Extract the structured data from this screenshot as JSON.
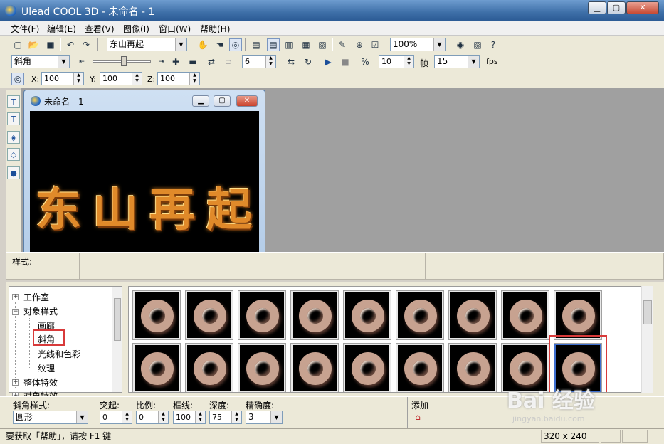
{
  "window": {
    "title": "Ulead COOL 3D - 未命名 - 1",
    "min": "▁",
    "max": "▢",
    "close": "✕"
  },
  "menu": [
    "文件(F)",
    "编辑(E)",
    "查看(V)",
    "图像(I)",
    "窗口(W)",
    "帮助(H)"
  ],
  "toolbar1": {
    "text_object": "东山再起",
    "zoom": "100%"
  },
  "toolbar2": {
    "attribute": "斜角",
    "frame_value": "6",
    "frames_value": "10",
    "frames_label": "帧",
    "fps_value": "15",
    "fps_label": "fps"
  },
  "toolbar3": {
    "x_label": "X:",
    "x_value": "100",
    "y_label": "Y:",
    "y_value": "100",
    "z_label": "Z:",
    "z_value": "100"
  },
  "child": {
    "title": "未命名 - 1",
    "text": [
      "东",
      "山",
      "再",
      "起"
    ]
  },
  "stylebar": {
    "label": "样式:"
  },
  "tree": {
    "items": [
      {
        "label": "工作室",
        "box": "+"
      },
      {
        "label": "对象样式",
        "box": "−"
      },
      {
        "label": "画廊"
      },
      {
        "label": "斜角"
      },
      {
        "label": "光线和色彩"
      },
      {
        "label": "纹理"
      },
      {
        "label": "整体特效",
        "box": "+"
      },
      {
        "label": "对象特效",
        "box": "+"
      }
    ]
  },
  "params": {
    "bevel_style_label": "斜角样式:",
    "bevel_style_value": "圆形",
    "protrusion_label": "突起:",
    "protrusion_value": "0",
    "scale_label": "比例:",
    "scale_value": "0",
    "border_label": "框线:",
    "border_value": "100",
    "depth_label": "深度:",
    "depth_value": "75",
    "precision_label": "精确度:",
    "precision_value": "3",
    "add_label": "添加"
  },
  "status": {
    "help": "要获取「帮助」，请按 F1 键",
    "size": "320 x 240"
  },
  "watermark": {
    "main": "Bai 经验",
    "sub": "jingyan.baidu.com"
  }
}
